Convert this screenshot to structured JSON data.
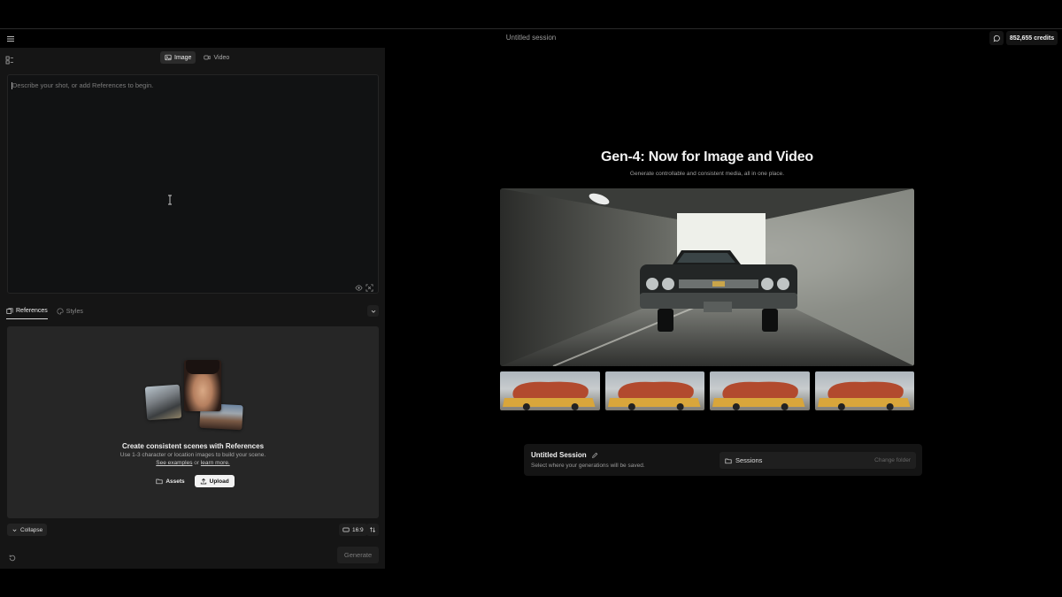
{
  "header": {
    "session_title": "Untitled session",
    "credits": "852,655 credits"
  },
  "left_panel": {
    "mode_tabs": [
      {
        "label": "Image",
        "icon": "image-icon",
        "active": true
      },
      {
        "label": "Video",
        "icon": "video-icon",
        "active": false
      }
    ],
    "prompt": {
      "value": "",
      "placeholder": "Describe your shot, or add References to begin."
    },
    "ref_tabs": [
      {
        "label": "References",
        "icon": "references-icon",
        "active": true
      },
      {
        "label": "Styles",
        "icon": "styles-icon",
        "active": false
      }
    ],
    "references": {
      "title": "Create consistent scenes with References",
      "subtitle": "Use 1-3 character or location images to build your scene.",
      "link_examples": "See examples",
      "link_or": "or",
      "link_learn": "learn more.",
      "assets_label": "Assets",
      "upload_label": "Upload"
    },
    "collapse_label": "Collapse",
    "aspect_ratio": "16:9",
    "generate_label": "Generate"
  },
  "hero": {
    "title": "Gen-4: Now for Image and Video",
    "subtitle": "Generate controllable and consistent media, all in one place."
  },
  "session_card": {
    "title": "Untitled Session",
    "subtitle": "Select where your generations will be saved.",
    "folder_label": "Sessions",
    "change_folder_label": "Change folder"
  },
  "colors": {
    "background": "#000000",
    "panel": "#151515",
    "accent_button": "#f2f2f2"
  }
}
